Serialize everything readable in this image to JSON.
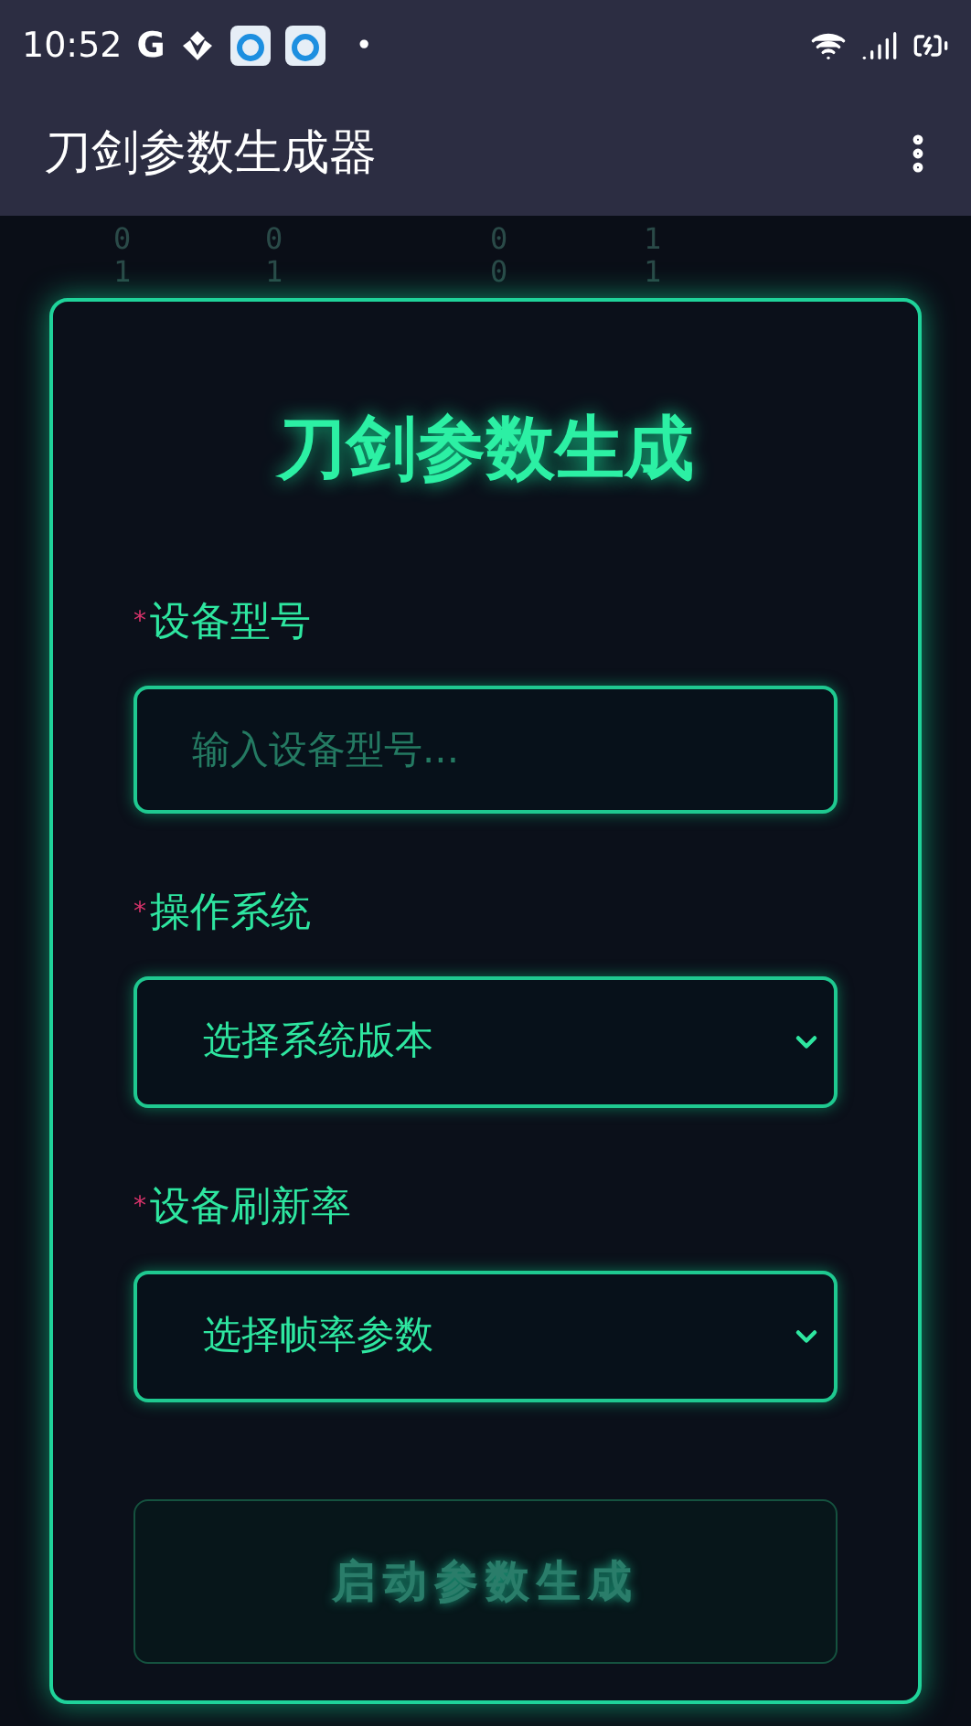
{
  "status_bar": {
    "time": "10:52",
    "letter": "G",
    "dot": "•"
  },
  "app_bar": {
    "title": "刀剑参数生成器"
  },
  "binary_rain": [
    "01",
    "01",
    "00",
    "11"
  ],
  "card": {
    "title": "刀剑参数生成",
    "fields": [
      {
        "kind": "input",
        "label": "设备型号",
        "required_mark": "*",
        "placeholder": "输入设备型号..."
      },
      {
        "kind": "select",
        "label": "操作系统",
        "required_mark": "*",
        "value": "选择系统版本"
      },
      {
        "kind": "select",
        "label": "设备刷新率",
        "required_mark": "*",
        "value": "选择帧率参数"
      }
    ],
    "button": {
      "label": "启动参数生成",
      "disabled": true
    }
  }
}
